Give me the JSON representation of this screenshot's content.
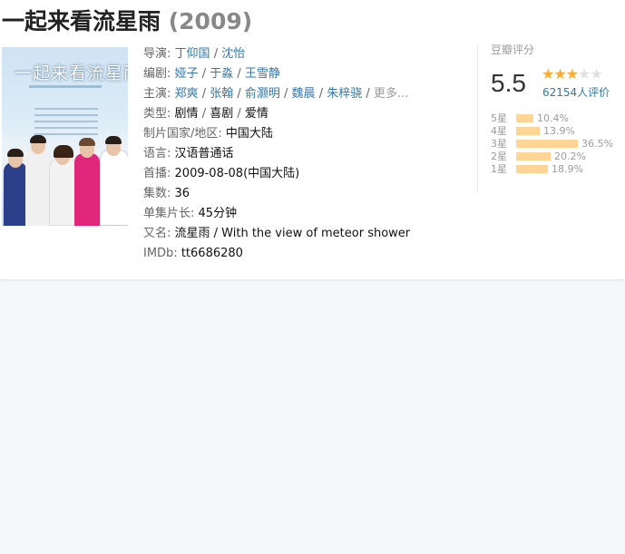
{
  "title": {
    "name": "一起来看流星雨",
    "year": "(2009)"
  },
  "poster": {
    "title_text": "一起来看流星雨"
  },
  "info": {
    "director": {
      "label": "导演",
      "values": [
        "丁仰国",
        "沈怡"
      ]
    },
    "writer": {
      "label": "编剧",
      "values": [
        "娅子",
        "于淼",
        "王雪静"
      ]
    },
    "cast": {
      "label": "主演",
      "values": [
        "郑爽",
        "张翰",
        "俞灏明",
        "魏晨",
        "朱梓骁"
      ],
      "more": "更多..."
    },
    "genre": {
      "label": "类型",
      "values": [
        "剧情",
        "喜剧",
        "爱情"
      ]
    },
    "country": {
      "label": "制片国家/地区",
      "value": "中国大陆"
    },
    "language": {
      "label": "语言",
      "value": "汉语普通话"
    },
    "premiere": {
      "label": "首播",
      "value": "2009-08-08(中国大陆)"
    },
    "episodes": {
      "label": "集数",
      "value": "36"
    },
    "runtime": {
      "label": "单集片长",
      "value": "45分钟"
    },
    "aka": {
      "label": "又名",
      "value": "流星雨 / With the view of meteor shower"
    },
    "imdb": {
      "label": "IMDb",
      "value": "tt6686280"
    }
  },
  "rating": {
    "title": "豆瓣评分",
    "score": "5.5",
    "stars_filled": 3,
    "stars_total": 5,
    "votes": "62154人评价",
    "star_color": "#ffac2d",
    "bar_color": "#ffd596",
    "distribution": [
      {
        "label": "5星",
        "percent": "10.4%",
        "value": 10.4
      },
      {
        "label": "4星",
        "percent": "13.9%",
        "value": 13.9
      },
      {
        "label": "3星",
        "percent": "36.5%",
        "value": 36.5
      },
      {
        "label": "2星",
        "percent": "20.2%",
        "value": 20.2
      },
      {
        "label": "1星",
        "percent": "18.9%",
        "value": 18.9
      }
    ]
  }
}
